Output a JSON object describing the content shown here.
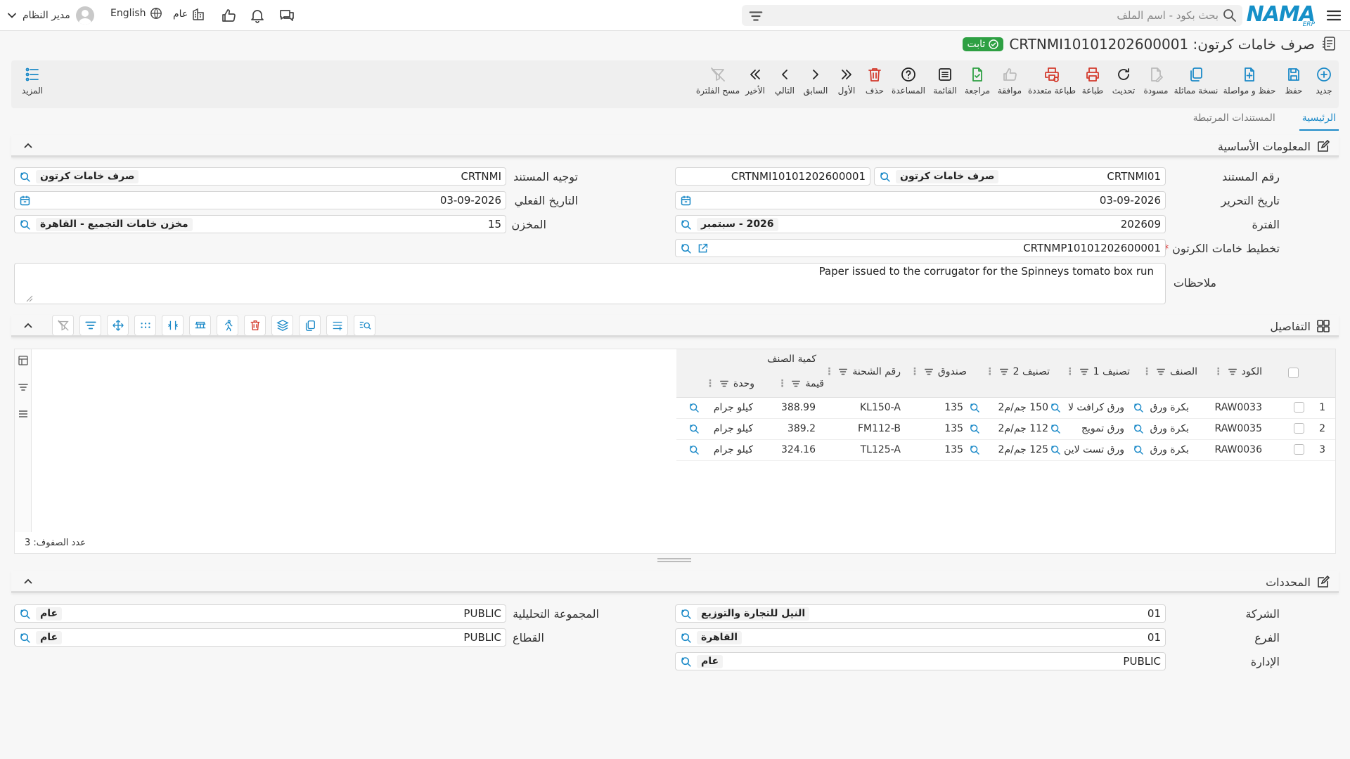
{
  "header": {
    "search_placeholder": "بحث بكود - اسم الملف",
    "brand": "NAMA",
    "brand_sub": "ERP",
    "user": "مدير النظام",
    "language": "English",
    "org": "عام"
  },
  "document": {
    "title": "صرف خامات كرتون: CRTNMI10101202600001",
    "status": "ثابت"
  },
  "toolbar": {
    "new": "جديد",
    "save": "حفظ",
    "save_continue": "حفظ و مواصلة",
    "clone": "نسخة مماثلة",
    "draft": "مسودة",
    "refresh": "تحديث",
    "print": "طباعة",
    "multi_print": "طباعة متعددة",
    "approve": "موافقة",
    "review": "مراجعة",
    "list": "القائمة",
    "help": "المساعدة",
    "delete": "حذف",
    "first": "الأول",
    "prev": "السابق",
    "next": "التالي",
    "last": "الأخير",
    "clear_filter": "مسح الفلترة",
    "more": "المزيد"
  },
  "tabs": {
    "main": "الرئيسية",
    "related": "المستندات المرتبطة"
  },
  "basic": {
    "section_title": "المعلومات الأساسية",
    "doc_no_label": "رقم المستند",
    "doc_type_code": "CRTNMI01",
    "doc_type_name": "صرف خامات كرتون",
    "doc_no": "CRTNMI10101202600001",
    "edit_date_label": "تاريخ التحرير",
    "edit_date": "03-09-2026",
    "period_label": "الفترة",
    "period_code": "202609",
    "period_name": "2026 - سبتمبر",
    "plan_label": "تخطيط خامات الكرتون",
    "plan_required": "*",
    "plan_value": "CRTNMP10101202600001",
    "notes_label": "ملاحظات",
    "notes": "Paper issued to the corrugator for the Spinneys tomato box run",
    "direction_label": "توجيه المستند",
    "direction_code": "CRTNMI",
    "direction_name": "صرف خامات كرتون",
    "actual_date_label": "التاريخ الفعلي",
    "actual_date": "03-09-2026",
    "warehouse_label": "المخزن",
    "warehouse_code": "15",
    "warehouse_name": "مخزن خامات التجميع - القاهرة"
  },
  "details": {
    "section_title": "التفاصيل",
    "columns": {
      "code": "الكود",
      "item": "الصنف",
      "class1": "تصنيف 1",
      "class2": "تصنيف 2",
      "box": "صندوق",
      "lot": "رقم الشحنة",
      "qty_group": "كمية الصنف",
      "value": "قيمة",
      "unit": "وحدة"
    },
    "rows": [
      {
        "n": "1",
        "code": "RAW0033",
        "item": "بكرة ورق",
        "class1": "ورق كرافت لا",
        "class2": "150 جم/م2",
        "box": "135",
        "lot": "KL150-A",
        "value": "388.99",
        "unit": "كيلو جرام"
      },
      {
        "n": "2",
        "code": "RAW0035",
        "item": "بكرة ورق",
        "class1": "ورق تمويج",
        "class2": "112 جم/م2",
        "box": "135",
        "lot": "FM112-B",
        "value": "389.2",
        "unit": "كيلو جرام"
      },
      {
        "n": "3",
        "code": "RAW0036",
        "item": "بكرة ورق",
        "class1": "ورق تست لاين",
        "class2": "125 جم/م2",
        "box": "135",
        "lot": "TL125-A",
        "value": "324.16",
        "unit": "كيلو جرام"
      }
    ],
    "row_count": "عدد الصفوف: 3"
  },
  "dimensions": {
    "section_title": "المحددات",
    "company_label": "الشركة",
    "company_code": "01",
    "company_name": "النيل للتجارة والتوزيع",
    "branch_label": "الفرع",
    "branch_code": "01",
    "branch_name": "القاهرة",
    "dept_label": "الإدارة",
    "dept_code": "PUBLIC",
    "dept_name": "عام",
    "analytic_label": "المجموعة التحليلية",
    "analytic_code": "PUBLIC",
    "analytic_name": "عام",
    "sector_label": "القطاع",
    "sector_code": "PUBLIC",
    "sector_name": "عام"
  },
  "colors": {
    "accent": "#1c8ac8",
    "status": "#2ea043",
    "danger": "#d33a2c"
  }
}
